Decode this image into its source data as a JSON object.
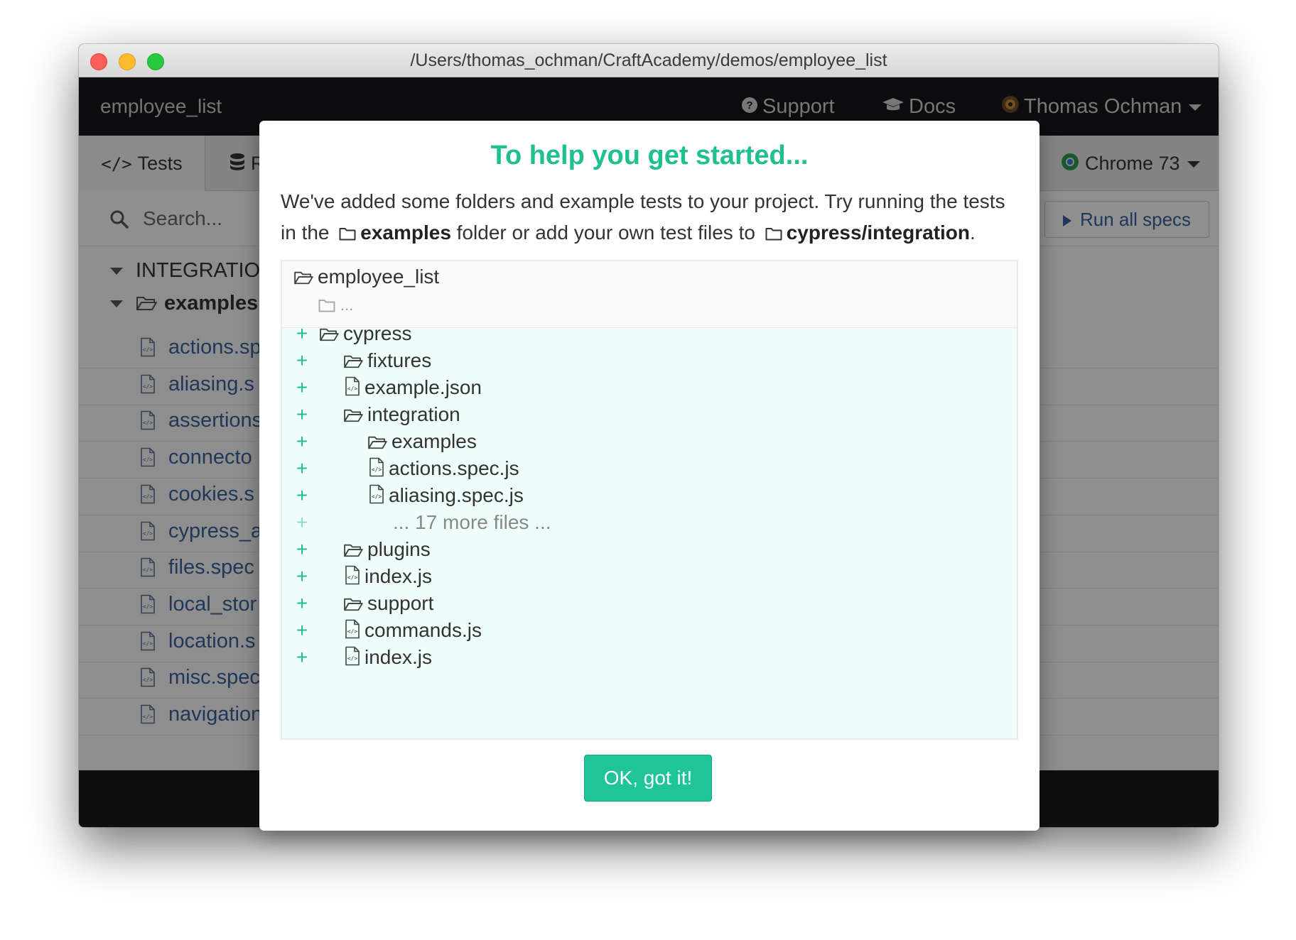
{
  "window": {
    "title": "/Users/thomas_ochman/CraftAcademy/demos/employee_list"
  },
  "nav": {
    "app_name": "employee_list",
    "support": "Support",
    "docs": "Docs",
    "user": "Thomas Ochman"
  },
  "tabs": {
    "tests": "Tests",
    "runs": "R",
    "browser": "Chrome 73"
  },
  "specs": {
    "search_placeholder": "Search...",
    "run_all": "Run all specs",
    "integration_header": "INTEGRATIO",
    "examples_folder": "examples",
    "files": [
      "actions.sp",
      "aliasing.s",
      "assertions",
      "connecto",
      "cookies.s",
      "cypress_a",
      "files.spec",
      "local_stor",
      "location.s",
      "misc.spec",
      "navigation"
    ]
  },
  "modal": {
    "title": "To help you get started...",
    "desc_part1": "We've added some folders and example tests to your project. Try running the tests in the",
    "desc_examples": "examples",
    "desc_part2": "folder or add your own test files to",
    "desc_integration": "cypress/integration",
    "desc_end": ".",
    "root_folder": "employee_list",
    "ellipsis": "...",
    "plus": "+",
    "tree": [
      {
        "label": "cypress",
        "type": "folder"
      },
      {
        "label": "fixtures",
        "type": "folder"
      },
      {
        "label": "example.json",
        "type": "file"
      },
      {
        "label": "integration",
        "type": "folder"
      },
      {
        "label": "examples",
        "type": "folder"
      },
      {
        "label": "actions.spec.js",
        "type": "file"
      },
      {
        "label": "aliasing.spec.js",
        "type": "file"
      },
      {
        "label": "... 17 more files ...",
        "type": "more"
      },
      {
        "label": "plugins",
        "type": "folder"
      },
      {
        "label": "index.js",
        "type": "file"
      },
      {
        "label": "support",
        "type": "folder"
      },
      {
        "label": "commands.js",
        "type": "file"
      },
      {
        "label": "index.js",
        "type": "file"
      }
    ],
    "ok_button": "OK, got it!"
  },
  "colors": {
    "accent_green": "#1fbf8f",
    "link_blue": "#3a5f9c",
    "nav_bg": "#18181b"
  }
}
